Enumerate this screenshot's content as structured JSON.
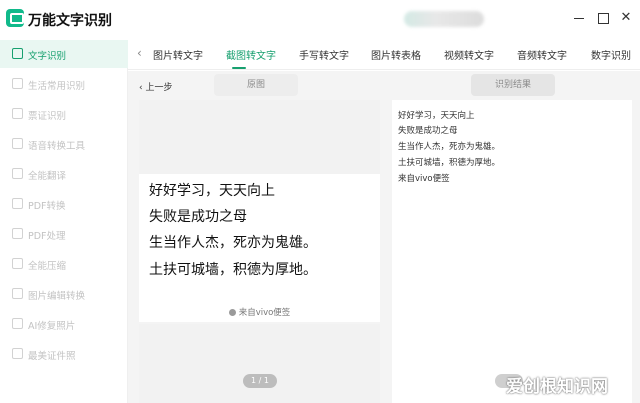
{
  "app": {
    "title": "万能文字识别"
  },
  "sidebar": {
    "items": [
      {
        "label": "文字识别",
        "active": true
      },
      {
        "label": "生活常用识别",
        "active": false
      },
      {
        "label": "票证识别",
        "active": false
      },
      {
        "label": "语音转换工具",
        "active": false
      },
      {
        "label": "全能翻译",
        "active": false
      },
      {
        "label": "PDF转换",
        "active": false
      },
      {
        "label": "PDF处理",
        "active": false
      },
      {
        "label": "全能压缩",
        "active": false
      },
      {
        "label": "图片编辑转换",
        "active": false
      },
      {
        "label": "AI修复照片",
        "active": false
      },
      {
        "label": "最美证件照",
        "active": false
      }
    ]
  },
  "tabs": [
    {
      "label": "图片转文字",
      "active": false
    },
    {
      "label": "截图转文字",
      "active": true
    },
    {
      "label": "手写转文字",
      "active": false
    },
    {
      "label": "图片转表格",
      "active": false
    },
    {
      "label": "视频转文字",
      "active": false
    },
    {
      "label": "音频转文字",
      "active": false
    },
    {
      "label": "数字识别",
      "active": false
    }
  ],
  "toolbar": {
    "back_label": "上一步",
    "source_label": "原图",
    "result_label": "识别结果"
  },
  "source": {
    "lines": [
      "好好学习，天天向上",
      "失败是成功之母",
      "生当作人杰，死亦为鬼雄。",
      "土扶可城墙，积德为厚地。"
    ],
    "footer": "来自vivo便签",
    "pager": "1 / 1"
  },
  "result": {
    "lines": [
      "好好学习，天天向上",
      "失败是成功之母",
      "生当作人杰，死亦为鬼雄。",
      "土扶可城墙，积德为厚地。",
      "来自vivo便签"
    ]
  },
  "watermark": "爱创根知识网",
  "colors": {
    "accent": "#17a06f",
    "panel_bg": "#f4f4f4"
  }
}
